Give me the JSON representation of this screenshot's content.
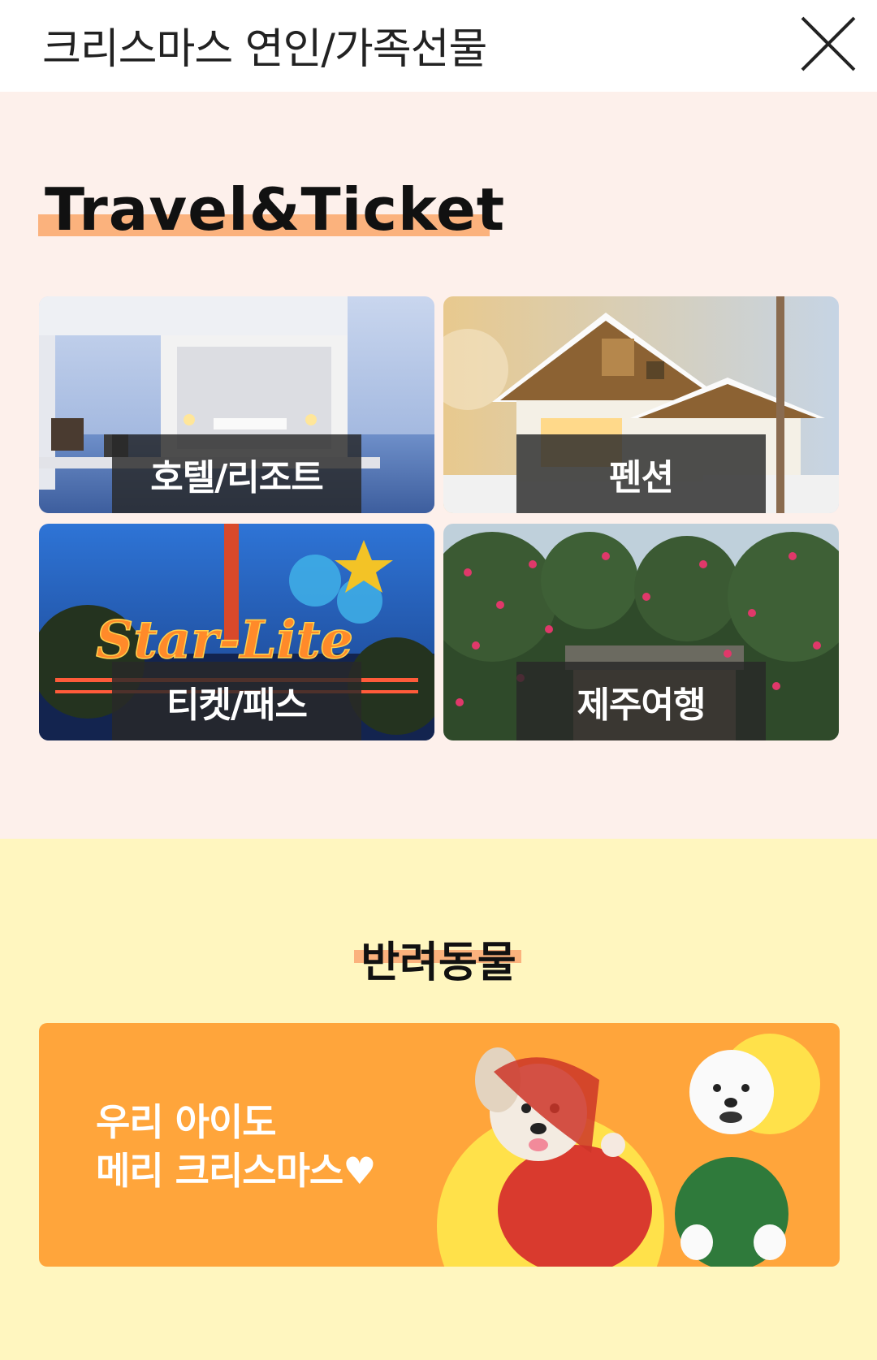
{
  "header": {
    "title": "크리스마스 연인/가족선물",
    "close_icon": "close-icon"
  },
  "travel": {
    "heading": "Travel&Ticket",
    "highlight_color": "#fbb27d",
    "background": "#fdf0eb",
    "tiles": [
      {
        "label": "호텔/리조트"
      },
      {
        "label": "펜션"
      },
      {
        "label": "티켓/패스"
      },
      {
        "label": "제주여행"
      }
    ]
  },
  "pet": {
    "heading": "반려동물",
    "background": "#fff6bf",
    "banner": {
      "line1": "우리 아이도",
      "line2": "메리 크리스마스♥",
      "color": "#ffa53b"
    }
  }
}
